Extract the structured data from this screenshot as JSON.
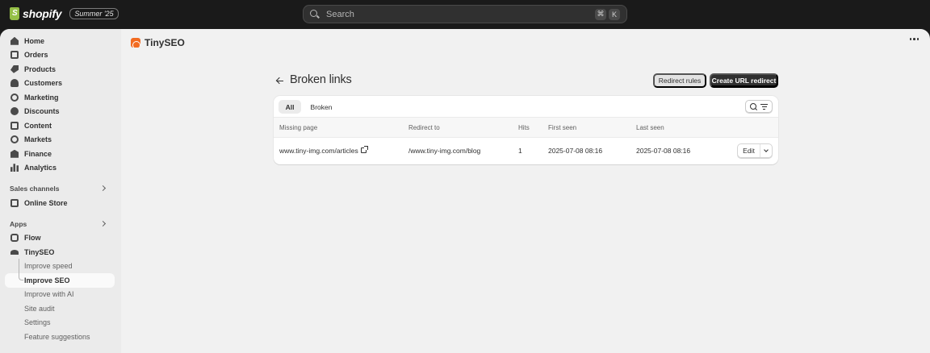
{
  "topbar": {
    "logo_text": "shopify",
    "edition_badge": "Summer '25",
    "search": {
      "placeholder": "Search",
      "shortcut_keys": [
        "⌘",
        "K"
      ]
    }
  },
  "sidebar": {
    "main_items": [
      {
        "label": "Home",
        "icon": "home-icon"
      },
      {
        "label": "Orders",
        "icon": "orders-icon"
      },
      {
        "label": "Products",
        "icon": "tag-icon"
      },
      {
        "label": "Customers",
        "icon": "person-icon"
      },
      {
        "label": "Marketing",
        "icon": "target-icon"
      },
      {
        "label": "Discounts",
        "icon": "discount-icon"
      },
      {
        "label": "Content",
        "icon": "content-icon"
      },
      {
        "label": "Markets",
        "icon": "globe-icon"
      },
      {
        "label": "Finance",
        "icon": "bank-icon"
      },
      {
        "label": "Analytics",
        "icon": "bar-chart-icon"
      }
    ],
    "sales_channels_label": "Sales channels",
    "online_store_label": "Online Store",
    "apps_label": "Apps",
    "flow_label": "Flow",
    "tinyseo_label": "TinySEO",
    "tinyseo_subitems": [
      {
        "label": "Improve speed",
        "active": false
      },
      {
        "label": "Improve SEO",
        "active": true
      },
      {
        "label": "Improve with AI",
        "active": false
      },
      {
        "label": "Site audit",
        "active": false
      },
      {
        "label": "Settings",
        "active": false
      },
      {
        "label": "Feature suggestions",
        "active": false
      }
    ]
  },
  "app_header": {
    "title": "TinySEO"
  },
  "page": {
    "title": "Broken links",
    "redirect_rules_label": "Redirect rules",
    "create_redirect_label": "Create URL redirect"
  },
  "tabs": [
    {
      "label": "All",
      "selected": true
    },
    {
      "label": "Broken",
      "selected": false
    }
  ],
  "table": {
    "columns": [
      "Missing page",
      "Redirect to",
      "Hits",
      "First seen",
      "Last seen"
    ],
    "rows": [
      {
        "missing_page": "www.tiny-img.com/articles",
        "redirect_to": "/www.tiny-img.com/blog",
        "hits": "1",
        "first_seen": "2025-07-08 08:16",
        "last_seen": "2025-07-08 08:16",
        "action_label": "Edit"
      }
    ]
  }
}
